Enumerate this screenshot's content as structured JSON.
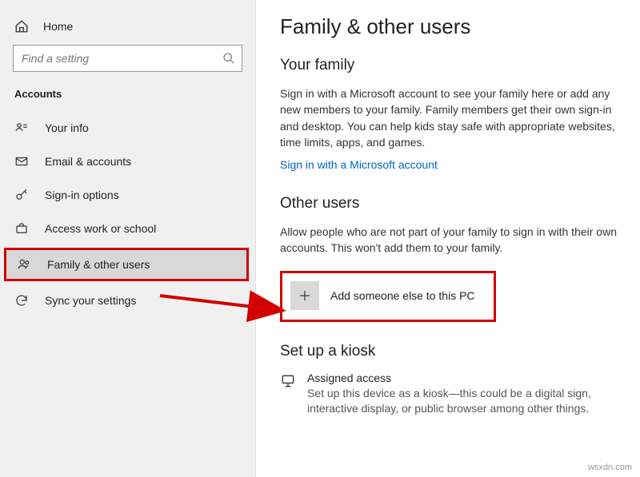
{
  "sidebar": {
    "home_label": "Home",
    "search_placeholder": "Find a setting",
    "category": "Accounts",
    "items": [
      {
        "label": "Your info"
      },
      {
        "label": "Email & accounts"
      },
      {
        "label": "Sign-in options"
      },
      {
        "label": "Access work or school"
      },
      {
        "label": "Family & other users"
      },
      {
        "label": "Sync your settings"
      }
    ]
  },
  "main": {
    "title": "Family & other users",
    "family": {
      "heading": "Your family",
      "body": "Sign in with a Microsoft account to see your family here or add any new members to your family. Family members get their own sign-in and desktop. You can help kids stay safe with appropriate websites, time limits, apps, and games.",
      "link": "Sign in with a Microsoft account"
    },
    "other": {
      "heading": "Other users",
      "body": "Allow people who are not part of your family to sign in with their own accounts. This won't add them to your family.",
      "add_label": "Add someone else to this PC"
    },
    "kiosk": {
      "heading": "Set up a kiosk",
      "title": "Assigned access",
      "desc": "Set up this device as a kiosk—this could be a digital sign, interactive display, or public browser among other things."
    }
  },
  "watermark": "wsxdn.com"
}
